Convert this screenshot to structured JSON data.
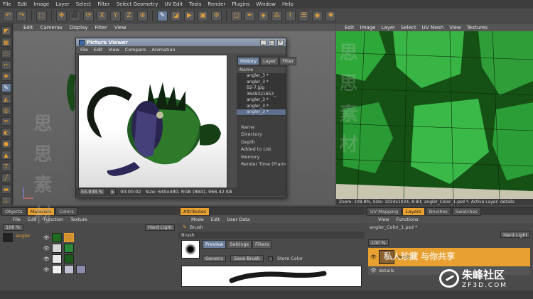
{
  "menubar": [
    "File",
    "Edit",
    "Image",
    "Layer",
    "Select",
    "Filter",
    "Select Geometry",
    "UV Edit",
    "Tools",
    "Render",
    "Plugins",
    "Window",
    "Help"
  ],
  "viewport": {
    "menu": [
      "Edit",
      "Cameras",
      "Display",
      "Filter",
      "View"
    ]
  },
  "picture_viewer": {
    "title": "Picture Viewer",
    "menu": [
      "File",
      "Edit",
      "View",
      "Compare",
      "Animation"
    ],
    "tabs": [
      "History",
      "Layer",
      "Filter"
    ],
    "column_header": "Name",
    "history": [
      "angler_3 *",
      "angler_3 *",
      "B2-7.jpg",
      "3649321653_",
      "angler_3 *",
      "angler_3 *",
      "angler_3 *"
    ],
    "info_labels": [
      "Name",
      "Directory",
      "Depth",
      "Added to List",
      "Memory",
      "Render Time (Frame"
    ],
    "status": {
      "zoom": "55.938 %",
      "time": "00:00:02",
      "size": "Size: 640x480, RGB (8Bit), 966.42 KB"
    }
  },
  "uv_view": {
    "menu": [
      "Edit",
      "Image",
      "Layer",
      "Select",
      "UV Mesh",
      "View",
      "Textures"
    ],
    "status": "Zoom: 108.8%, Size: 1024x1024, 8 Bit, angler_Color_1.psd *, Active Layer: details"
  },
  "materials_panel": {
    "tabs": [
      "Objects",
      "Materials",
      "Colors"
    ],
    "menu": [
      "File",
      "Edit",
      "Function",
      "Texture"
    ],
    "zoom": "100 %",
    "mode": "Hard Light",
    "object_name": "angler"
  },
  "attributes_panel": {
    "tabs": [
      "Attributes"
    ],
    "menu": [
      "Mode",
      "Edit",
      "User Data"
    ],
    "tool_label": "Brush",
    "section": "Brush",
    "subtabs": [
      "Preview",
      "Settings",
      "Filters"
    ],
    "preset": "Generic",
    "save_button": "Save Brush",
    "store_color": "Store Color"
  },
  "layers_panel": {
    "tabs": [
      "UV Mapping",
      "Layers",
      "Brushes",
      "Swatches"
    ],
    "menu": [
      "View",
      "Functions"
    ],
    "file": "angler_Color_1.psd *",
    "mode": "Hard Light",
    "zoom": "100 %",
    "layers": [
      "details",
      "details"
    ]
  },
  "watermark": {
    "cn": "私人珍藏 与你共享",
    "brand": "朱峰社区",
    "url": "ZF3D.COM",
    "side": "思 思 素 材"
  },
  "colors": {
    "accent": "#e8a030",
    "uv_green": "#1d5a1d",
    "selection": "#5d6f8c"
  }
}
